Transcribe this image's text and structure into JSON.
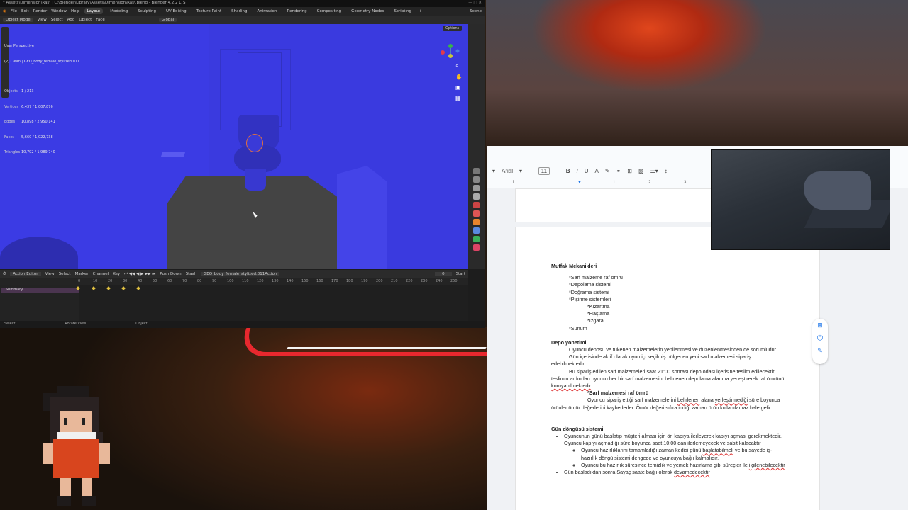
{
  "blender": {
    "title": "* Assets\\Dimension\\Ras\\ | C:\\Blender\\Library\\Assets\\Dimension\\Ras\\.blend - Blender 4.2.2 LTS",
    "menu": [
      "File",
      "Edit",
      "Render",
      "Window",
      "Help"
    ],
    "workspaces": [
      "Layout",
      "Modeling",
      "Sculpting",
      "UV Editing",
      "Texture Paint",
      "Shading",
      "Animation",
      "Rendering",
      "Compositing",
      "Geometry Nodes",
      "Scripting"
    ],
    "active_workspace": "Layout",
    "scene_label": "Scene",
    "header": {
      "mode": "Object Mode",
      "items": [
        "View",
        "Select",
        "Add",
        "Object",
        "Face"
      ],
      "transform": "Global"
    },
    "viewport": {
      "perspective": "User Perspective",
      "collection": "(2) Clean | GEO_body_female_stylized.011",
      "stats": [
        {
          "k": "Objects",
          "v": "1 / 213"
        },
        {
          "k": "Vertices",
          "v": "6,437 / 1,007,876"
        },
        {
          "k": "Edges",
          "v": "10,898 / 2,950,141"
        },
        {
          "k": "Faces",
          "v": "5,660 / 1,022,738"
        },
        {
          "k": "Triangles",
          "v": "10,792 / 1,989,740"
        }
      ],
      "options_label": "Options"
    },
    "action_editor": {
      "label": "Action Editor",
      "items": [
        "View",
        "Select",
        "Marker",
        "Channel",
        "Key"
      ],
      "push_down": "Push Down",
      "stash": "Stash",
      "action_name": "GEO_body_female_stylized.011Action",
      "frame": "0",
      "start_label": "Start",
      "summary": "Summary",
      "ruler": [
        "0",
        "10",
        "20",
        "30",
        "40",
        "50",
        "60",
        "70",
        "80",
        "90",
        "100",
        "110",
        "120",
        "130",
        "140",
        "150",
        "160",
        "170",
        "180",
        "190",
        "200",
        "210",
        "220",
        "230",
        "240",
        "250"
      ]
    },
    "status": [
      "Select",
      "Rotate View",
      "Object"
    ]
  },
  "docs": {
    "font": "Arial",
    "font_size": "11",
    "ruler": [
      "1",
      "1",
      "2",
      "3",
      "4"
    ],
    "title": "Mutfak Mekanikleri",
    "list1": [
      "*Sarf malzeme raf ömrü",
      "*Depolama sistemi",
      "*Doğrama sistemi",
      "*Pişirme sistemleri"
    ],
    "list1_sub": [
      "*Kızartma",
      "*Haşlama",
      "*Izgara"
    ],
    "list1_end": "*Sunum",
    "depo_title": "Depo yönetimi",
    "depo_p1": "Oyuncu deposu ve tükenen malzemelerin yenilenmesi ve düzenlenmesinden de sorumludur.",
    "depo_p2": "Gün içerisinde aktif olarak oyun içi seçilmiş bölgeden yeni sarf malzemesi sipariş edebilmektedir.",
    "depo_p3a": "Bu sipariş edilen sarf malzemeleri saat 21:00 sonrası depo odası içerisine teslim edilecektir, teslimin ardından oyuncu her bir sarf malzemesini belirlenen depolama alanına yerleştirerek raf ömrünü ",
    "depo_p3b": "koruyabilmektedir",
    "raf_title": "*Sarf malzemesi raf ömrü",
    "raf_p_a": "Oyuncu sipariş ettiği sarf malzemelerini ",
    "raf_p_b": "belirlenen",
    "raf_p_c": " alana ",
    "raf_p_d": "yerleştirmediği",
    "raf_p_e": " süre boyunca ürünler ömür değerlerini kaybederler. Ömür değeri sıfıra indiği zaman ürün kullanılamaz hale gelir",
    "gun_title": "Gün döngüsü sistemi",
    "gun_b1": "Oyuncunun günü başlatıp müşteri alması için ön kapıya ilerleyerek kapıyı açması gerekmektedir. Oyuncu kapıyı açmadığı süre boyunca saat 10:00 dan ilerlemeyecek ve sabit kalacaktır",
    "gun_s1_a": "Oyuncu hazırlıklarını tamamladığı zaman kedisi günü ",
    "gun_s1_b": "başlatabilmeli",
    "gun_s1_c": " ve bu sayede iş-hazırlık döngü sistemi dengede ve oyuncuya bağlı kalmalıdır.",
    "gun_s2_a": "Oyuncu bu hazırlık süresince temizlik ve yemek hazırlama gibi süreçler ile ",
    "gun_s2_b": "ilgilenebilecektir",
    "gun_b2_a": "Gün başladıktan sonra Sayaç saate bağlı olarak ",
    "gun_b2_b": "devamedecektir"
  },
  "colors": {
    "viewport_blue": "#3a3adf",
    "accent_red": "#e8282e",
    "docs_link": "#1a73e8"
  }
}
